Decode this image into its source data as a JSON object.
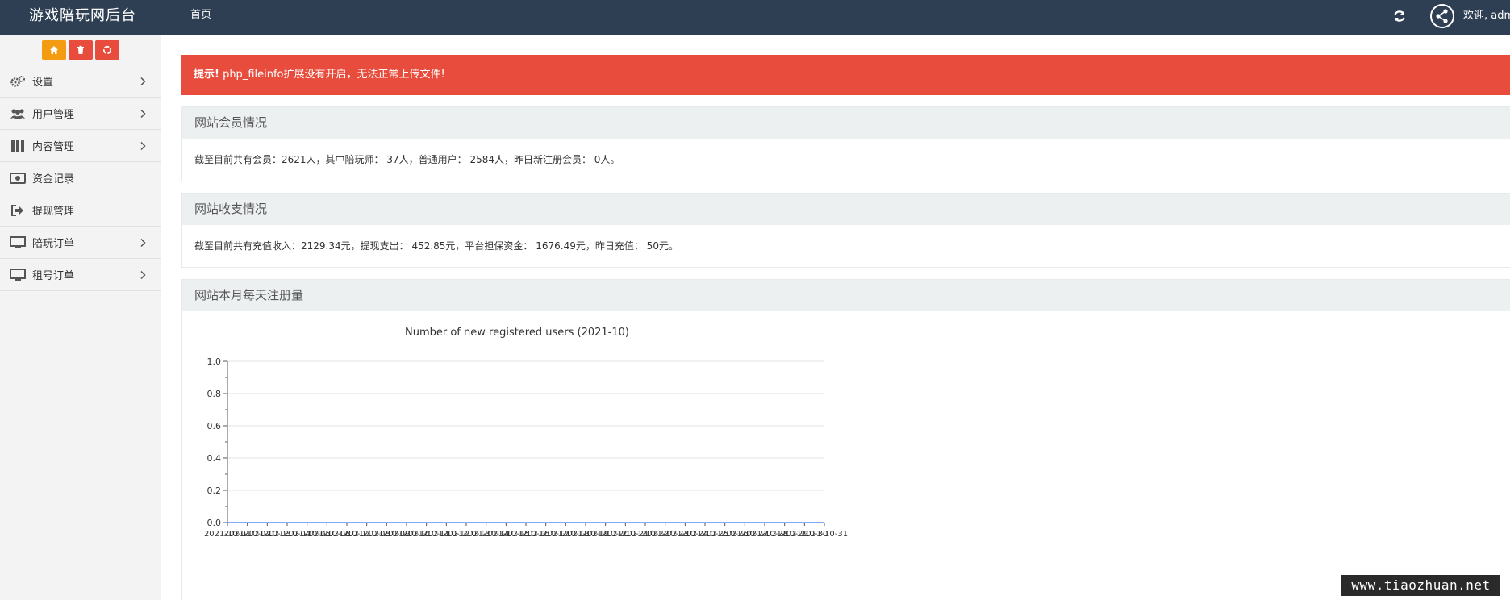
{
  "header": {
    "brand": "游戏陪玩网后台",
    "nav_home": "首页",
    "welcome": "欢迎, admin"
  },
  "sidebar": {
    "quick_buttons": [
      {
        "icon": "home-icon",
        "color": "#f39c12"
      },
      {
        "icon": "trash-icon",
        "color": "#e74c3c"
      },
      {
        "icon": "recycle-icon",
        "color": "#e74c3c"
      }
    ],
    "items": [
      {
        "label": "设置",
        "icon": "gears-icon",
        "has_submenu": true
      },
      {
        "label": "用户管理",
        "icon": "users-icon",
        "has_submenu": true
      },
      {
        "label": "内容管理",
        "icon": "grid-icon",
        "has_submenu": true
      },
      {
        "label": "资金记录",
        "icon": "money-icon",
        "has_submenu": false
      },
      {
        "label": "提现管理",
        "icon": "sign-out-icon",
        "has_submenu": false
      },
      {
        "label": "陪玩订单",
        "icon": "monitor-icon",
        "has_submenu": true
      },
      {
        "label": "租号订单",
        "icon": "monitor-icon",
        "has_submenu": true
      }
    ]
  },
  "alert": {
    "prefix": "提示!",
    "message": " php_fileinfo扩展没有开启，无法正常上传文件!",
    "color": "#e84c3d"
  },
  "members_panel": {
    "title": "网站会员情况",
    "text": "截至目前共有会员：2621人，其中陪玩师： 37人，普通用户： 2584人，昨日新注册会员： 0人。"
  },
  "finance_panel": {
    "title": "网站收支情况",
    "text": "截至目前共有充值收入：2129.34元，提现支出： 452.85元，平台担保资金： 1676.49元，昨日充值： 50元。"
  },
  "chart_panel": {
    "title": "网站本月每天注册量"
  },
  "chart_data": {
    "type": "line",
    "title": "Number of new registered users (2021-10)",
    "x": [
      "2021-10-01",
      "2021-10-02",
      "2021-10-03",
      "2021-10-04",
      "2021-10-05",
      "2021-10-06",
      "2021-10-07",
      "2021-10-08",
      "2021-10-09",
      "2021-10-10",
      "2021-10-11",
      "2021-10-12",
      "2021-10-13",
      "2021-10-14",
      "2021-10-15",
      "2021-10-16",
      "2021-10-17",
      "2021-10-18",
      "2021-10-19",
      "2021-10-20",
      "2021-10-21",
      "2021-10-22",
      "2021-10-23",
      "2021-10-24",
      "2021-10-25",
      "2021-10-26",
      "2021-10-27",
      "2021-10-28",
      "2021-10-29",
      "2021-10-30",
      "2021-10-31"
    ],
    "values": [
      0,
      0,
      0,
      0,
      0,
      0,
      0,
      0,
      0,
      0,
      0,
      0,
      0,
      0,
      0,
      0,
      0,
      0,
      0,
      0,
      0,
      0,
      0,
      0,
      0,
      0,
      0,
      0,
      0,
      0,
      0
    ],
    "yticks": [
      "0.0",
      "0.2",
      "0.4",
      "0.6",
      "0.8",
      "1.0"
    ],
    "ylim": [
      0,
      1
    ],
    "grid": true
  },
  "watermark": "www.tiaozhuan.net"
}
